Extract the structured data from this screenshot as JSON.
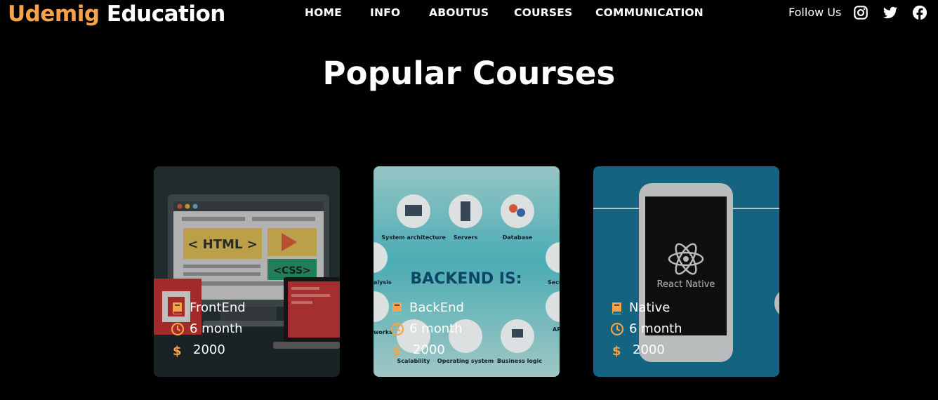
{
  "brand": {
    "accent": "Udemig",
    "rest": "Education",
    "accent_color": "#f5a34a"
  },
  "nav": {
    "items": [
      {
        "label": "HOME"
      },
      {
        "label": "INFO"
      },
      {
        "label": "ABOUTUS"
      },
      {
        "label": "COURSES"
      },
      {
        "label": "COMMUNICATION"
      }
    ]
  },
  "social": {
    "follow_label": "Follow Us",
    "icons": [
      "instagram-icon",
      "twitter-icon",
      "facebook-icon"
    ]
  },
  "section": {
    "title": "Popular Courses"
  },
  "courses": [
    {
      "name": "FrontEnd",
      "duration": "6 month",
      "price": "2000",
      "image": {
        "html_tag": "< HTML >",
        "css_tag": "<CSS>"
      }
    },
    {
      "name": "BackEnd",
      "duration": "6 month",
      "price": "2000",
      "image": {
        "heading": "BACKEND IS:",
        "topics": [
          "System architecture",
          "Servers",
          "Database",
          "alysis",
          "Secu",
          "works",
          "AP",
          "Scalability",
          "Operating system",
          "Business logic"
        ]
      }
    },
    {
      "name": "Native",
      "duration": "6 month",
      "price": "2000",
      "image": {
        "label": "React Native"
      }
    }
  ],
  "icons": {
    "course_icon": "book-icon",
    "duration_icon": "clock-icon",
    "price_icon": "dollar-icon"
  },
  "colors": {
    "accent": "#f5a34a",
    "background": "#000000",
    "text": "#ffffff"
  }
}
